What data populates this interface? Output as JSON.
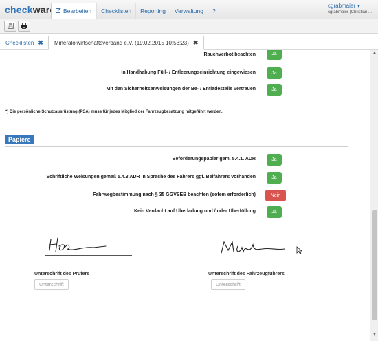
{
  "app": {
    "logo_part1": "check",
    "logo_part2": "ware"
  },
  "nav": {
    "items": [
      {
        "label": "Bearbeiten",
        "icon": "edit-icon",
        "active": true
      },
      {
        "label": "Checklisten"
      },
      {
        "label": "Reporting"
      },
      {
        "label": "Verwaltung"
      },
      {
        "label": "?"
      }
    ],
    "user": {
      "name": "cgrabmaier",
      "sub": "cgrabmaier (Christian ..."
    }
  },
  "toolbar": {
    "buttons": [
      {
        "icon": "save-icon"
      },
      {
        "icon": "print-icon"
      }
    ]
  },
  "tabs": [
    {
      "label": "Checklisten"
    },
    {
      "label": "Mineralölwirtschaftsverband e.V. (19.02.2015 10:53:23)"
    }
  ],
  "checklist_top": [
    {
      "label": "Rauchverbot beachten",
      "answer": "Ja"
    },
    {
      "label": "In Handhabung Füll- / Entleerungseinrichtung eingewiesen",
      "answer": "Ja"
    },
    {
      "label": "Mit den Sicherheitsanweisungen der Be- / Entladestelle vertrauen",
      "answer": "Ja"
    }
  ],
  "note": "*) Die persönliche Schutzausrüstung (PSA) muss für jedes Mitglied der Fahrzeugbesatzung mitgeführt werden.",
  "section_papiere": {
    "title": "Papiere",
    "items": [
      {
        "label": "Beförderungspapier gem. 5.4.1. ADR",
        "answer": "Ja"
      },
      {
        "label": "Schriftliche Weisungen gemäß 5.4.3 ADR in Sprache des Fahrers ggf. Beifahrers vorhanden",
        "answer": "Ja"
      },
      {
        "label": "Fahrwegbestimmung nach § 35 GGVSEB beachten (sofem erforderlich)",
        "answer": "Nein"
      },
      {
        "label": "Kein Verdacht auf Überladung und / oder Überfüllung",
        "answer": "Ja"
      }
    ]
  },
  "signatures": {
    "pruefer": {
      "caption": "Unterschrift des Prüfers",
      "button": "Unterschrift"
    },
    "fahrer": {
      "caption": "Unterschrift des Fahrzeugführers",
      "button": "Unterschrift"
    }
  },
  "colors": {
    "ja": "#4fae4f",
    "nein": "#d9534f",
    "section": "#3a78bd",
    "link": "#2a6aa8"
  }
}
